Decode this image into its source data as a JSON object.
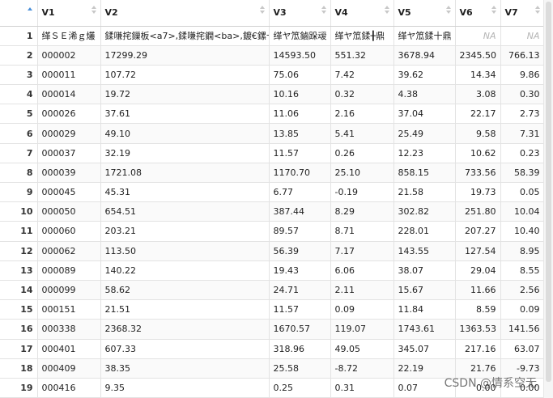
{
  "columns": [
    "V1",
    "V2",
    "V3",
    "V4",
    "V5",
    "V6",
    "V7"
  ],
  "rows": [
    {
      "n": "1",
      "cells": [
        "缂ＳＥ浠ｇ爜",
        "鍒嗛挓鏁板<a7>,鍒嗛挓鐗<ba>,鍍€鏍十鼎",
        "缂ヤ笟鏀跺叆",
        "缂ヤ笟鍒╂鼎",
        "缂ヤ笟鍒十鼎",
        "NA",
        "NA"
      ]
    },
    {
      "n": "2",
      "cells": [
        "000002",
        "17299.29",
        "14593.50",
        "551.32",
        "3678.94",
        "2345.50",
        "766.13"
      ]
    },
    {
      "n": "3",
      "cells": [
        "000011",
        "107.72",
        "75.06",
        "7.42",
        "39.62",
        "14.34",
        "9.86"
      ]
    },
    {
      "n": "4",
      "cells": [
        "000014",
        "19.72",
        "10.16",
        "0.32",
        "4.38",
        "3.08",
        "0.30"
      ]
    },
    {
      "n": "5",
      "cells": [
        "000026",
        "37.61",
        "11.06",
        "2.16",
        "37.04",
        "22.17",
        "2.73"
      ]
    },
    {
      "n": "6",
      "cells": [
        "000029",
        "49.10",
        "13.85",
        "5.41",
        "25.49",
        "9.58",
        "7.31"
      ]
    },
    {
      "n": "7",
      "cells": [
        "000037",
        "32.19",
        "11.57",
        "0.26",
        "12.23",
        "10.62",
        "0.23"
      ]
    },
    {
      "n": "8",
      "cells": [
        "000039",
        "1721.08",
        "1170.70",
        "25.10",
        "858.15",
        "733.56",
        "58.39"
      ]
    },
    {
      "n": "9",
      "cells": [
        "000045",
        "45.31",
        "6.77",
        "-0.19",
        "21.58",
        "19.73",
        "0.05"
      ]
    },
    {
      "n": "10",
      "cells": [
        "000050",
        "654.51",
        "387.44",
        "8.29",
        "302.82",
        "251.80",
        "10.04"
      ]
    },
    {
      "n": "11",
      "cells": [
        "000060",
        "203.21",
        "89.57",
        "8.71",
        "228.01",
        "207.27",
        "10.40"
      ]
    },
    {
      "n": "12",
      "cells": [
        "000062",
        "113.50",
        "56.39",
        "7.17",
        "143.55",
        "127.54",
        "8.95"
      ]
    },
    {
      "n": "13",
      "cells": [
        "000089",
        "140.22",
        "19.43",
        "6.06",
        "38.07",
        "29.04",
        "8.55"
      ]
    },
    {
      "n": "14",
      "cells": [
        "000099",
        "58.62",
        "24.71",
        "2.11",
        "15.67",
        "11.66",
        "2.56"
      ]
    },
    {
      "n": "15",
      "cells": [
        "000151",
        "21.51",
        "11.57",
        "0.09",
        "11.84",
        "8.59",
        "0.09"
      ]
    },
    {
      "n": "16",
      "cells": [
        "000338",
        "2368.32",
        "1670.57",
        "119.07",
        "1743.61",
        "1363.53",
        "141.56"
      ]
    },
    {
      "n": "17",
      "cells": [
        "000401",
        "607.33",
        "318.96",
        "49.05",
        "345.07",
        "217.16",
        "63.07"
      ]
    },
    {
      "n": "18",
      "cells": [
        "000409",
        "38.35",
        "25.58",
        "-8.72",
        "22.19",
        "21.76",
        "-9.73"
      ]
    },
    {
      "n": "19",
      "cells": [
        "000416",
        "9.35",
        "0.25",
        "0.31",
        "0.07",
        "0.00",
        "0.00"
      ]
    }
  ],
  "watermark": "CSDN @情系空无"
}
